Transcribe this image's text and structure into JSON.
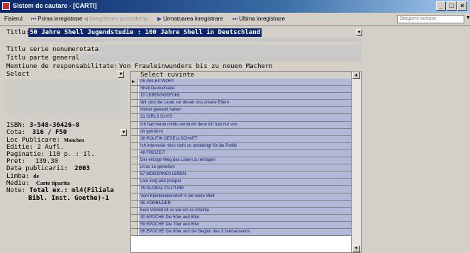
{
  "window": {
    "title": "Sistem de cautare - [CARTI]",
    "buttons": [
      "_",
      "□",
      "×"
    ]
  },
  "menu": {
    "items": [
      {
        "label": "Fisierul",
        "icon": "",
        "disabled": false
      },
      {
        "label": "Prima inregistrare",
        "icon": "⏮",
        "disabled": false
      },
      {
        "label": "Inregistrare precedenta",
        "icon": "◀",
        "disabled": true
      },
      {
        "label": "Urmatoarea inregistrare",
        "icon": "▶",
        "disabled": false
      },
      {
        "label": "Ultima inregistrare",
        "icon": "⏭",
        "disabled": false
      }
    ],
    "help_placeholder": "Введите вопрос"
  },
  "form": {
    "titlu_label": "Titlu:",
    "titlu_value": "50 Jahre Shell Jugendstudie : 100 Jahre Shell in Deutschland",
    "serie_label": "Titlu serie nenumerotata:",
    "parte_label": "Titlu parte generala",
    "mentiune_label": "Mentiune de responsabilitate:",
    "mentiune_value": "Von Frauleinwunders bis zu neuen Machern",
    "select_label": "Select",
    "cuvinte_header": "Select cuvinte"
  },
  "keywords": [
    "05 GELEITWORT",
    "Shell Deutschland",
    "10 LEBENSGEFÜHL",
    "Wir sind die Leute vor denen uns unsere Eltern",
    "immer gewarnt haben",
    "21 GIRLS GUYS",
    "Ich hab heute nichts verrdumt denn ich hab nur von",
    "dir getrdumt",
    "38 POLITIK GESELLSCHAFT",
    "Ich interessie mich nicht so unbedingt für die Politik",
    "49 FREIZEIT",
    "Der einzige Weg das Leben zu ertragen",
    "ist es zu genießen",
    "67 MODERNES LEBEN",
    "Live long and prosper",
    "76 GLOBAL CULTURE",
    "Vom Kleinkleckersdorf in die weite Welt",
    "95 VORBILDER",
    "Kein Vorbild ist so wie ich es möchte",
    "30 EPOCHE Die 50er und 60er",
    "59 EPOCHE Die 70er und 80er",
    "86 EPOCHE Die 90er und der Beginn des 3.Jahrtausends"
  ],
  "details": {
    "isbn_label": "ISBN:",
    "isbn_value": "3-548-36426-8",
    "cota_label": "Cota:",
    "cota_value": "316 / F50",
    "loc_label": "Loc Publicare:",
    "loc_value": "Munchen",
    "editie_label": "Editie:",
    "editie_value": "2 Aufl.",
    "paginatie_label": "Paginatie:",
    "paginatie_value": "110 p. : il.",
    "pret_label": "Pret:",
    "pret_value": "139.30",
    "data_label": "Data publicarii:",
    "data_value": "2003",
    "limba_label": "Limba:",
    "limba_value": "de",
    "mediu_label": "Mediu:",
    "mediu_value": "Carte tiparita",
    "note_label": "Note:",
    "note_value_1": "Total ex.: ml4(Filiala",
    "note_value_2": "Bibl. Inst. Goethe)-1"
  },
  "colors": {
    "title_blue": "#0a246a",
    "grid_cell": "#b2b8d8",
    "window_bg": "#d4d0c8"
  }
}
